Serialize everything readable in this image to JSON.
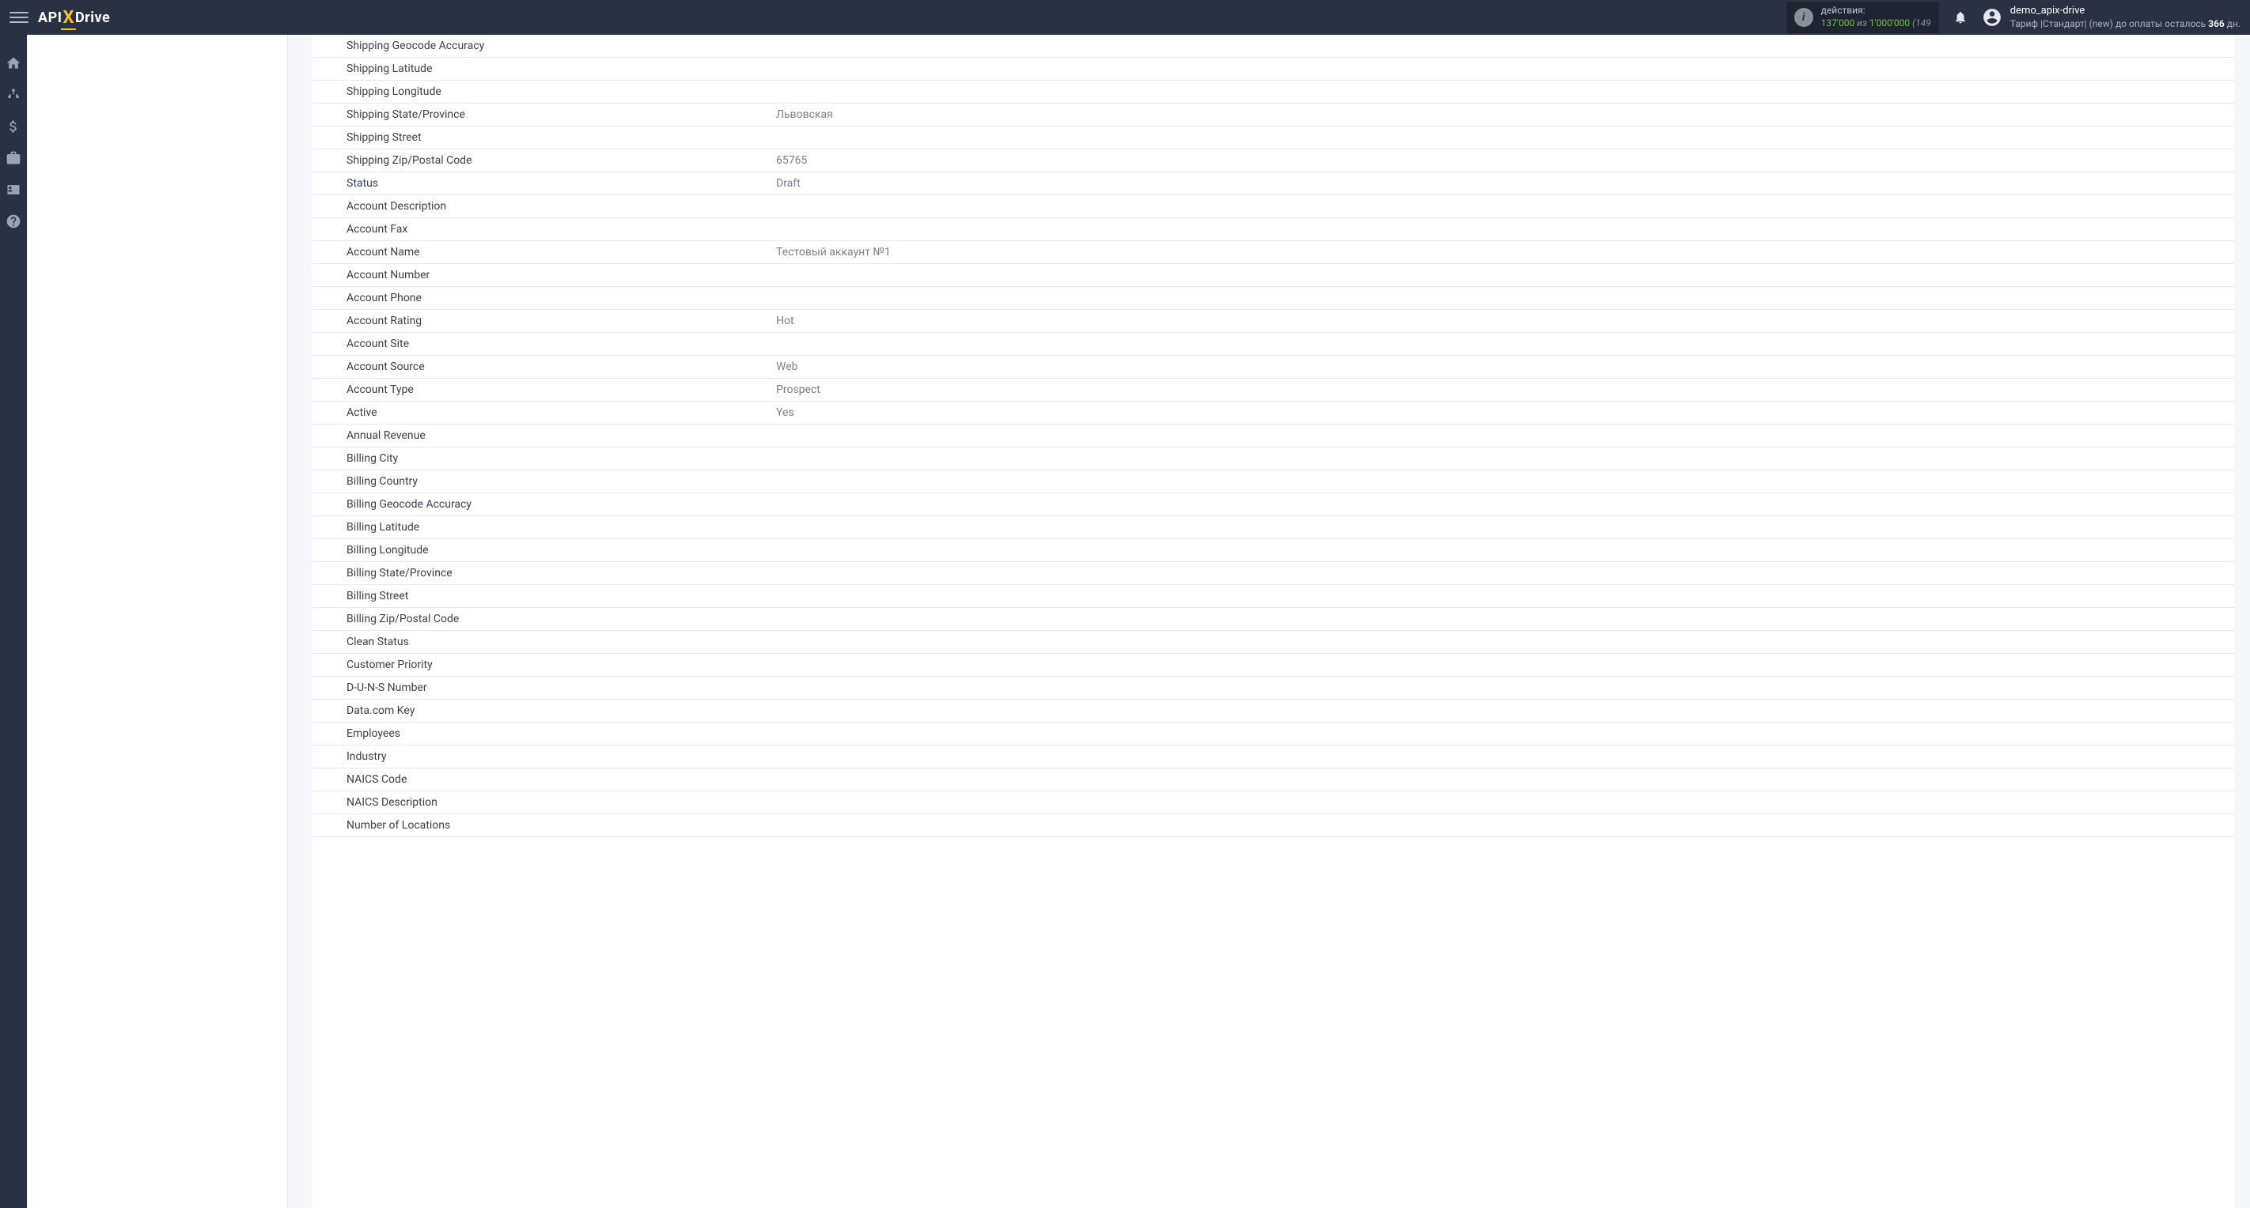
{
  "header": {
    "logo": {
      "part1": "API",
      "part2": "X",
      "part3": "Drive"
    },
    "actions": {
      "label": "действия:",
      "used": "137'000",
      "sep": " из ",
      "total": "1'000'000",
      "extra": " (149"
    },
    "user": {
      "name": "demo_apix-drive",
      "plan_prefix": "Тариф |Стандарт| (new) до оплаты осталось ",
      "days": "366",
      "days_suffix": " дн."
    }
  },
  "fields": [
    {
      "label": "Shipping Geocode Accuracy",
      "value": ""
    },
    {
      "label": "Shipping Latitude",
      "value": ""
    },
    {
      "label": "Shipping Longitude",
      "value": ""
    },
    {
      "label": "Shipping State/Province",
      "value": "Львовская"
    },
    {
      "label": "Shipping Street",
      "value": ""
    },
    {
      "label": "Shipping Zip/Postal Code",
      "value": "65765"
    },
    {
      "label": "Status",
      "value": "Draft"
    },
    {
      "label": "Account Description",
      "value": ""
    },
    {
      "label": "Account Fax",
      "value": ""
    },
    {
      "label": "Account Name",
      "value": "Тестовый аккаунт №1"
    },
    {
      "label": "Account Number",
      "value": ""
    },
    {
      "label": "Account Phone",
      "value": ""
    },
    {
      "label": "Account Rating",
      "value": "Hot"
    },
    {
      "label": "Account Site",
      "value": ""
    },
    {
      "label": "Account Source",
      "value": "Web"
    },
    {
      "label": "Account Type",
      "value": "Prospect"
    },
    {
      "label": "Active",
      "value": "Yes"
    },
    {
      "label": "Annual Revenue",
      "value": ""
    },
    {
      "label": "Billing City",
      "value": ""
    },
    {
      "label": "Billing Country",
      "value": ""
    },
    {
      "label": "Billing Geocode Accuracy",
      "value": ""
    },
    {
      "label": "Billing Latitude",
      "value": ""
    },
    {
      "label": "Billing Longitude",
      "value": ""
    },
    {
      "label": "Billing State/Province",
      "value": ""
    },
    {
      "label": "Billing Street",
      "value": ""
    },
    {
      "label": "Billing Zip/Postal Code",
      "value": ""
    },
    {
      "label": "Clean Status",
      "value": ""
    },
    {
      "label": "Customer Priority",
      "value": ""
    },
    {
      "label": "D-U-N-S Number",
      "value": ""
    },
    {
      "label": "Data.com Key",
      "value": ""
    },
    {
      "label": "Employees",
      "value": ""
    },
    {
      "label": "Industry",
      "value": ""
    },
    {
      "label": "NAICS Code",
      "value": ""
    },
    {
      "label": "NAICS Description",
      "value": ""
    },
    {
      "label": "Number of Locations",
      "value": ""
    }
  ]
}
